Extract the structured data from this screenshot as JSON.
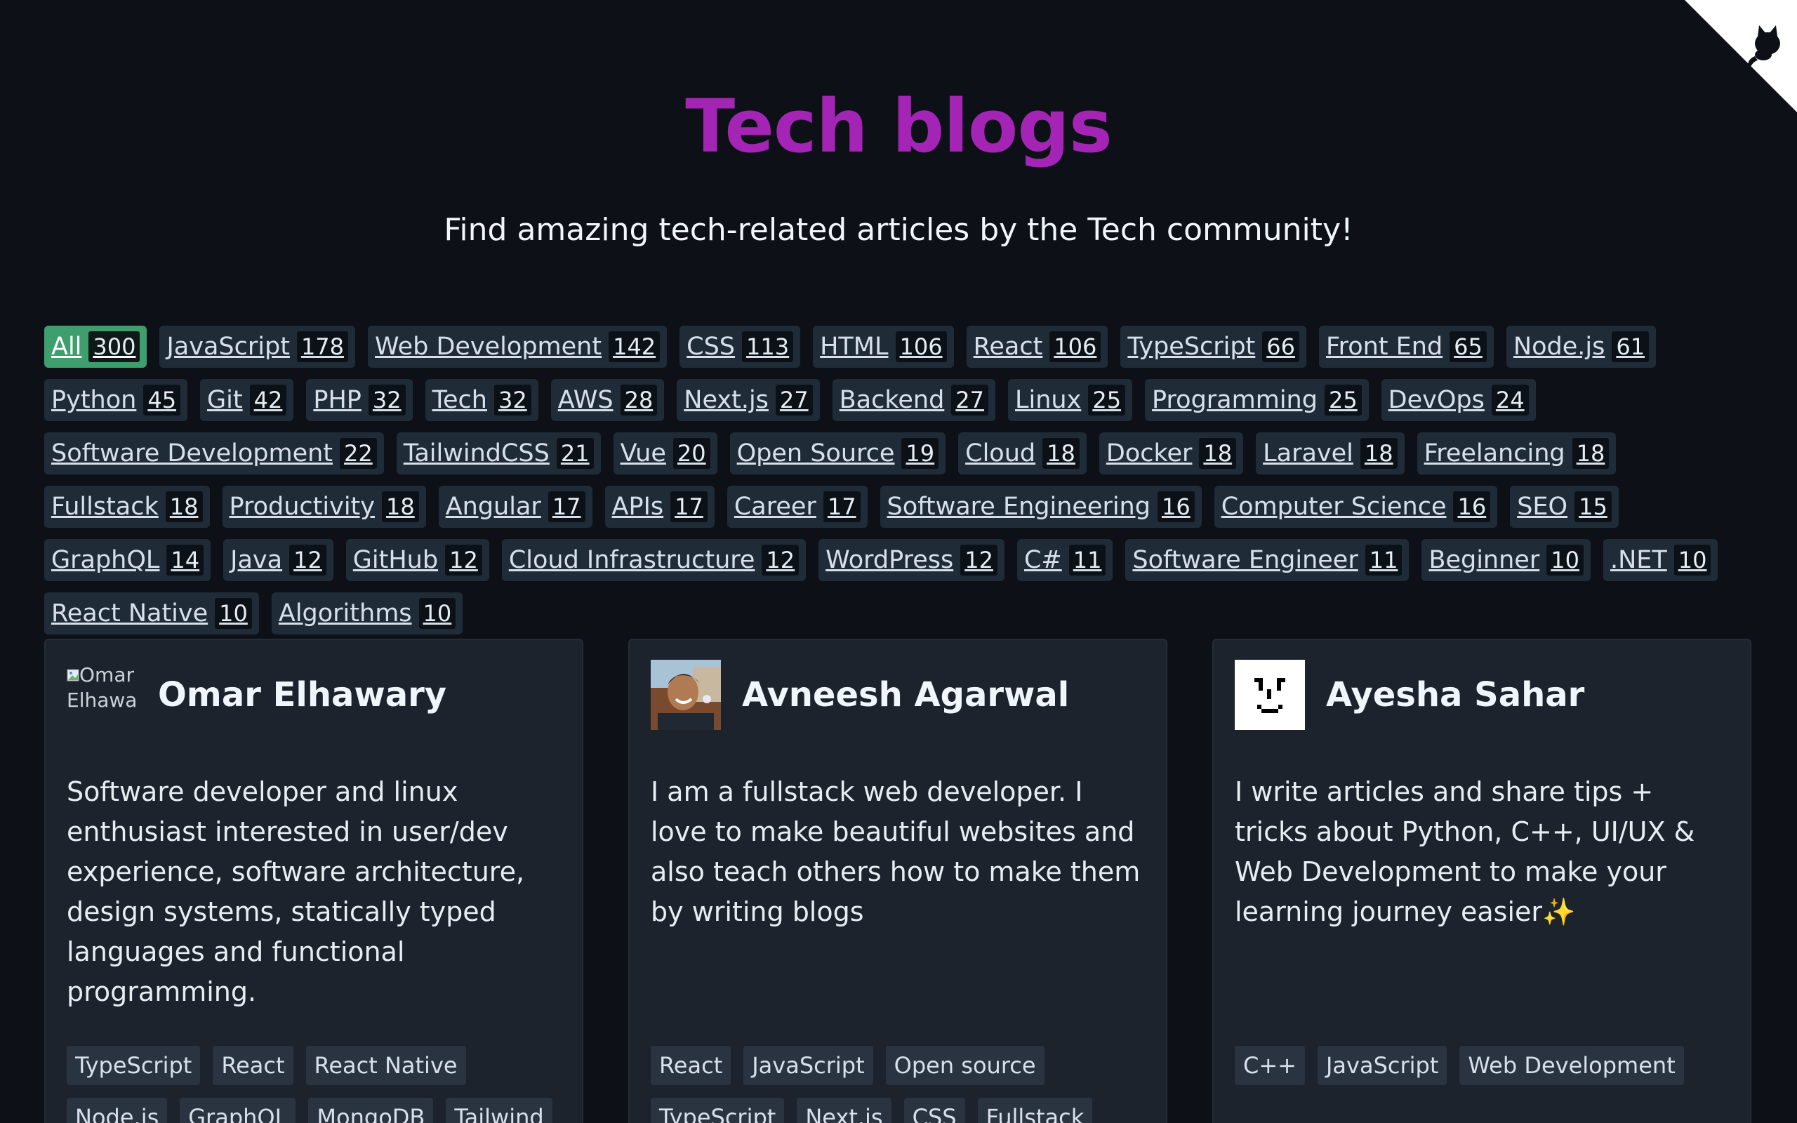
{
  "header": {
    "title": "Tech blogs",
    "subtitle": "Find amazing tech-related articles by the Tech community!"
  },
  "colors": {
    "title": "#a424b5",
    "active_tag": "#3e9e6d",
    "background": "#0d1117"
  },
  "tags": [
    {
      "label": "All",
      "count": "300",
      "active": true
    },
    {
      "label": "JavaScript",
      "count": "178"
    },
    {
      "label": "Web Development",
      "count": "142"
    },
    {
      "label": "CSS",
      "count": "113"
    },
    {
      "label": "HTML",
      "count": "106"
    },
    {
      "label": "React",
      "count": "106"
    },
    {
      "label": "TypeScript",
      "count": "66"
    },
    {
      "label": "Front End",
      "count": "65"
    },
    {
      "label": "Node.js",
      "count": "61"
    },
    {
      "label": "Python",
      "count": "45"
    },
    {
      "label": "Git",
      "count": "42"
    },
    {
      "label": "PHP",
      "count": "32"
    },
    {
      "label": "Tech",
      "count": "32"
    },
    {
      "label": "AWS",
      "count": "28"
    },
    {
      "label": "Next.js",
      "count": "27"
    },
    {
      "label": "Backend",
      "count": "27"
    },
    {
      "label": "Linux",
      "count": "25"
    },
    {
      "label": "Programming",
      "count": "25"
    },
    {
      "label": "DevOps",
      "count": "24"
    },
    {
      "label": "Software Development",
      "count": "22"
    },
    {
      "label": "TailwindCSS",
      "count": "21"
    },
    {
      "label": "Vue",
      "count": "20"
    },
    {
      "label": "Open Source",
      "count": "19"
    },
    {
      "label": "Cloud",
      "count": "18"
    },
    {
      "label": "Docker",
      "count": "18"
    },
    {
      "label": "Laravel",
      "count": "18"
    },
    {
      "label": "Freelancing",
      "count": "18"
    },
    {
      "label": "Fullstack",
      "count": "18"
    },
    {
      "label": "Productivity",
      "count": "18"
    },
    {
      "label": "Angular",
      "count": "17"
    },
    {
      "label": "APIs",
      "count": "17"
    },
    {
      "label": "Career",
      "count": "17"
    },
    {
      "label": "Software Engineering",
      "count": "16"
    },
    {
      "label": "Computer Science",
      "count": "16"
    },
    {
      "label": "SEO",
      "count": "15"
    },
    {
      "label": "GraphQL",
      "count": "14"
    },
    {
      "label": "Java",
      "count": "12"
    },
    {
      "label": "GitHub",
      "count": "12"
    },
    {
      "label": "Cloud Infrastructure",
      "count": "12"
    },
    {
      "label": "WordPress",
      "count": "12"
    },
    {
      "label": "C#",
      "count": "11"
    },
    {
      "label": "Software Engineer",
      "count": "11"
    },
    {
      "label": "Beginner",
      "count": "10"
    },
    {
      "label": ".NET",
      "count": "10"
    },
    {
      "label": "React Native",
      "count": "10"
    },
    {
      "label": "Algorithms",
      "count": "10"
    }
  ],
  "cards": [
    {
      "name": "Omar Elhawary",
      "avatar_alt": "Omar Elhawary",
      "avatar": "broken-image",
      "bio": "Software developer and linux enthusiast interested in user/dev experience, software architecture, design systems, statically typed languages and functional programming.",
      "tags": [
        "TypeScript",
        "React",
        "React Native",
        "Node.js",
        "GraphQL",
        "MongoDB",
        "Tailwind"
      ]
    },
    {
      "name": "Avneesh Agarwal",
      "avatar": "photo",
      "bio": "I am a fullstack web developer. I love to make beautiful websites and also teach others how to make them by writing blogs",
      "tags": [
        "React",
        "JavaScript",
        "Open source",
        "TypeScript",
        "Next.js",
        "CSS",
        "Fullstack"
      ]
    },
    {
      "name": "Ayesha Sahar",
      "avatar": "pixel-face",
      "bio": "I write articles and share tips + tricks about Python, C++, UI/UX & Web Development to make your learning journey easier✨",
      "tags": [
        "C++",
        "JavaScript",
        "Web Development"
      ]
    }
  ],
  "corner": {
    "icon": "github-octocat-icon"
  }
}
